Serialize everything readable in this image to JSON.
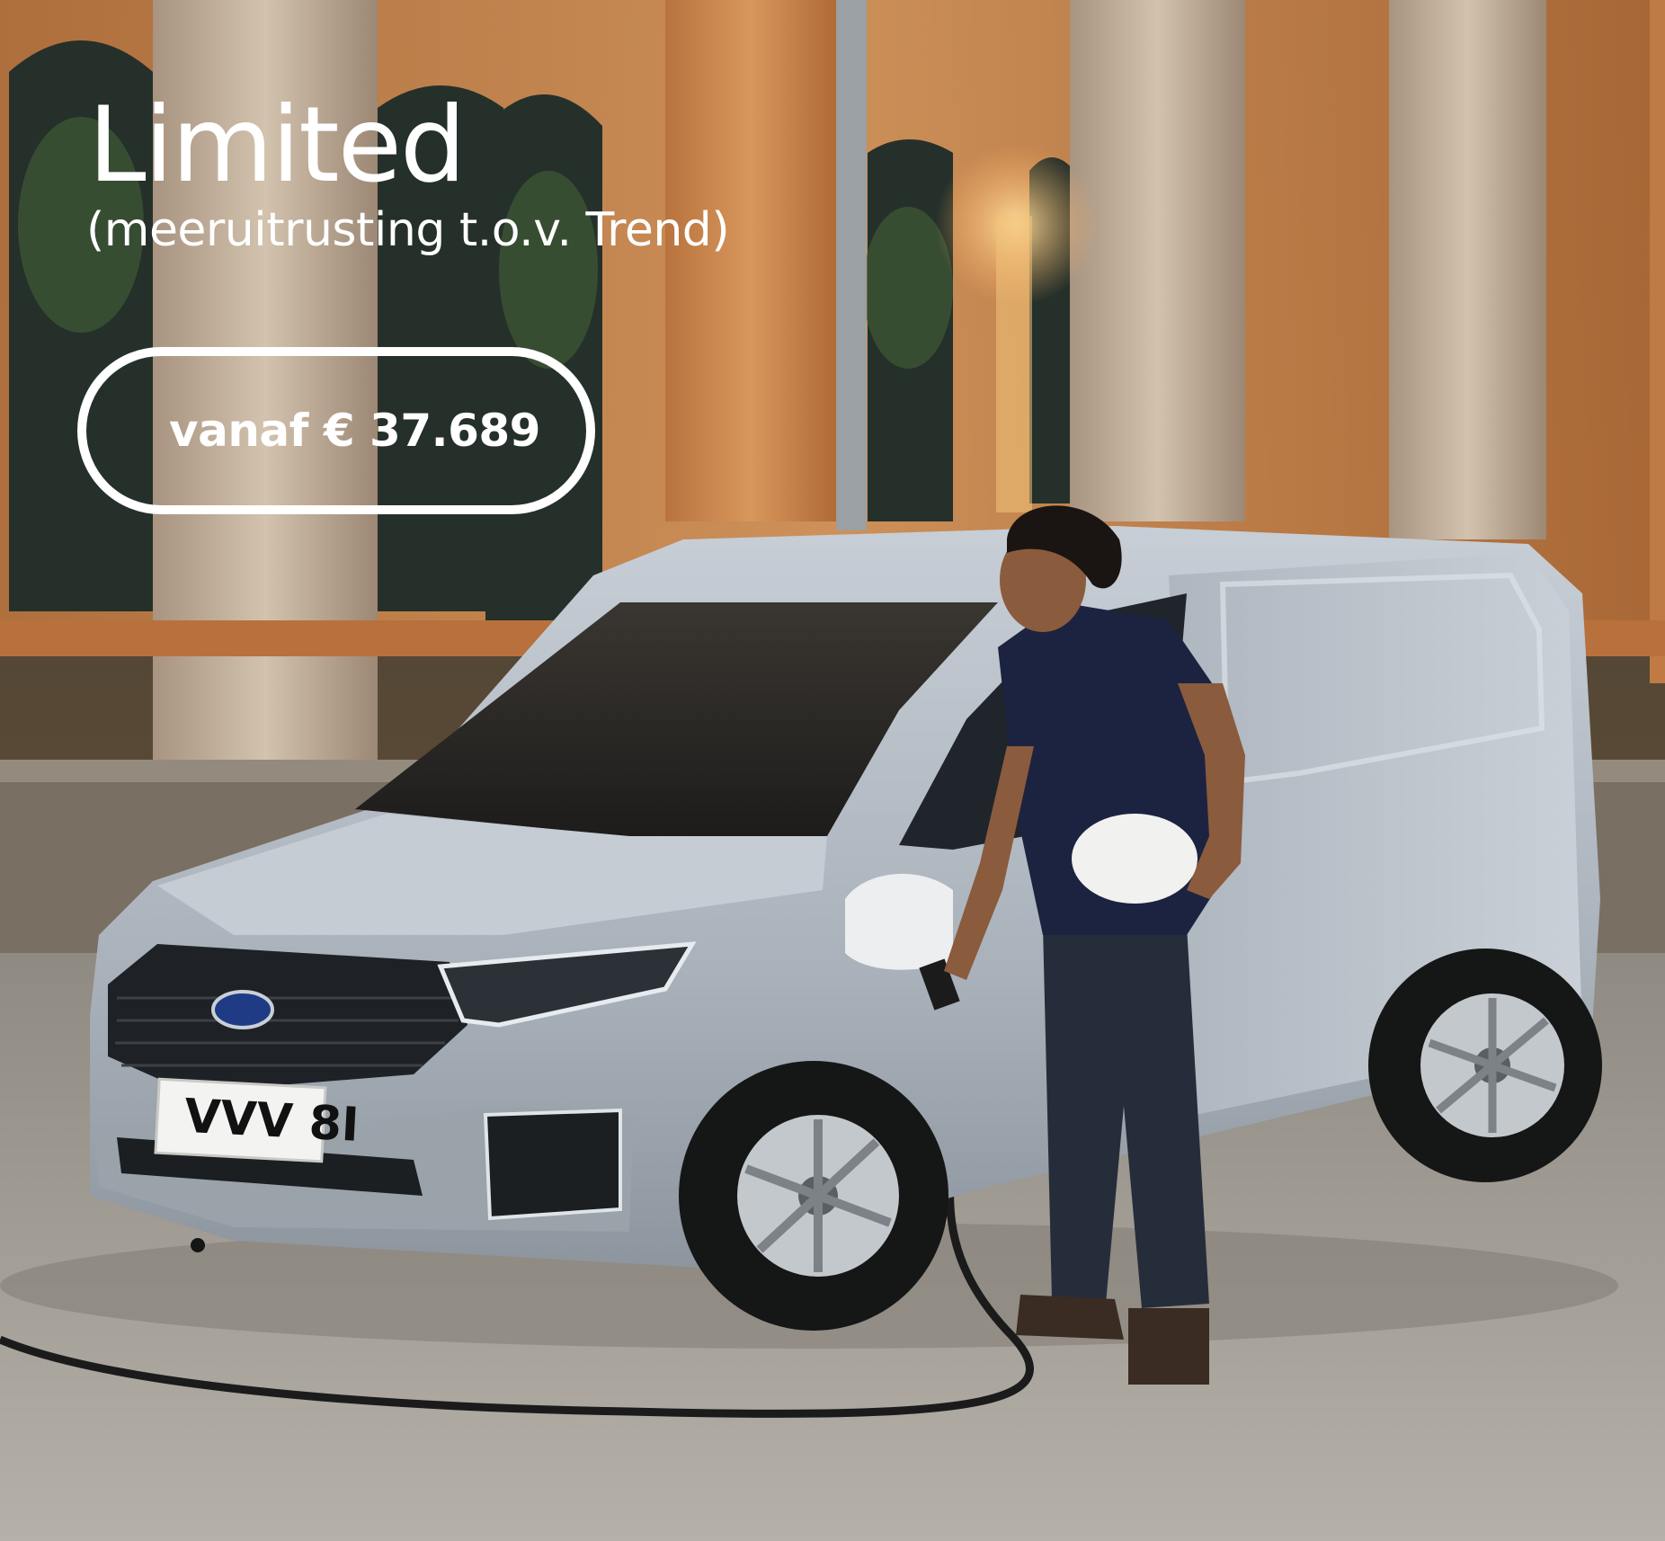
{
  "headline": {
    "title": "Limited",
    "subtitle": "(meeruitrusting t.o.v. Trend)"
  },
  "price_badge": {
    "label": "vanaf € 37.689"
  },
  "vehicle": {
    "license_plate": "VVV 8I",
    "brand_emblem": "Ford"
  },
  "colors": {
    "overlay_text": "#ffffff",
    "van_body": "#b9c0c7",
    "brick_wall": "#c9874e",
    "pillar": "#c9b8a4"
  }
}
